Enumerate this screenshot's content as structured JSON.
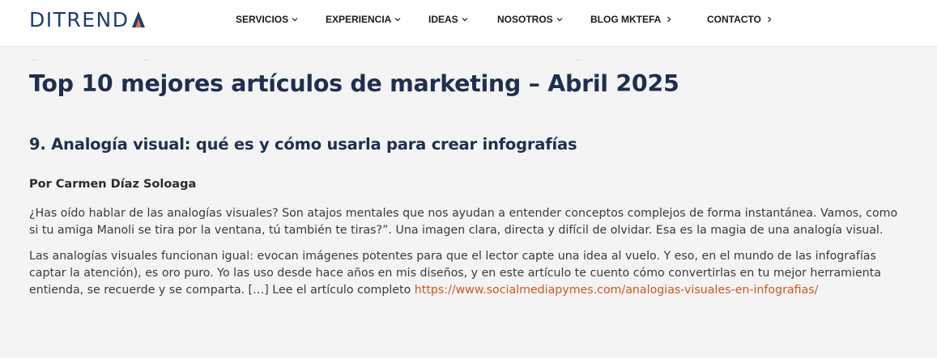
{
  "header": {
    "logo_text": "DITREND",
    "logo_mark_letter": "A",
    "nav": [
      {
        "label": "SERVICIOS",
        "icon": "chevron-down-icon"
      },
      {
        "label": "EXPERIENCIA",
        "icon": "chevron-down-icon"
      },
      {
        "label": "IDEAS",
        "icon": "chevron-down-icon"
      },
      {
        "label": "NOSOTROS",
        "icon": "chevron-down-icon"
      },
      {
        "label": "BLOG MKTEFA",
        "icon": "chevron-right-icon"
      },
      {
        "label": "CONTACTO",
        "icon": "chevron-right-icon"
      }
    ]
  },
  "article": {
    "title": "Top 10 mejores artículos de marketing – Abril 2025",
    "section_title": "9. Analogía visual: qué es y cómo usarla para crear infografías",
    "author": "Por Carmen Díaz Soloaga",
    "paragraph1_lines": [
      "¿Has oído hablar de las analogías visuales? Son atajos mentales que nos ayudan a entender conceptos complejos de forma instantánea. Vamos, como",
      "si tu amiga Manoli se tira por la ventana, tú también te tiras?”. Una imagen clara, directa y difícil de olvidar. Esa es la magia de una analogía visual."
    ],
    "paragraph2_lines": [
      "Las analogías visuales funcionan igual: evocan imágenes potentes para que el lector capte una idea al vuelo. Y eso, en el mundo de las infografías",
      "captar la atención), es oro puro. Yo las uso desde hace años en mis diseños, y en este artículo te cuento cómo convertirlas en tu mejor herramienta",
      "entienda, se recuerde y se comparta. […] Lee el artículo completo "
    ],
    "link_text": "https://www.socialmediapymes.com/analogias-visuales-en-infografias/"
  },
  "colors": {
    "brand_navy": "#1c3d78",
    "brand_orange": "#e8732a",
    "heading": "#1f2f4f",
    "link": "#d2561c",
    "page_bg": "#f4f4f5"
  }
}
